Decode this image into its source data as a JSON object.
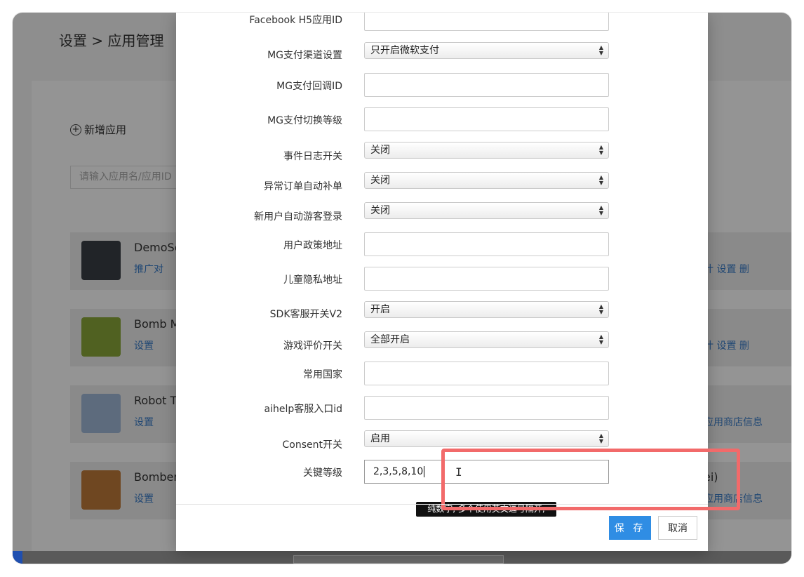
{
  "background": {
    "breadcrumb": "设置 > 应用管理",
    "add_app_label": "新增应用",
    "search_placeholder": "请输入应用名/应用ID",
    "apps": [
      {
        "name": "DemoSc",
        "sub": "推广对",
        "right": "计  设置  删",
        "icon_color": "#3a3f45"
      },
      {
        "name": "Bomb M",
        "sub": "设置",
        "right": "计  设置  删",
        "icon_color": "#8aa83a"
      },
      {
        "name": "Robot T",
        "sub": "设置",
        "right": "应用商店信息",
        "icon_color": "#a0b8d8"
      },
      {
        "name": "Bomber",
        "sub": "设置",
        "right": "应用商店信息",
        "right_top": "ei)",
        "icon_color": "#c07a3a"
      }
    ]
  },
  "modal": {
    "fields": [
      {
        "label": "Facebook H5应用ID",
        "type": "input",
        "value": ""
      },
      {
        "label": "MG支付渠道设置",
        "type": "select",
        "value": "只开启微软支付"
      },
      {
        "label": "MG支付回调ID",
        "type": "input",
        "value": ""
      },
      {
        "label": "MG支付切换等级",
        "type": "input",
        "value": ""
      },
      {
        "label": "事件日志开关",
        "type": "select",
        "value": "关闭"
      },
      {
        "label": "异常订单自动补单",
        "type": "select",
        "value": "关闭"
      },
      {
        "label": "新用户自动游客登录",
        "type": "select",
        "value": "关闭"
      },
      {
        "label": "用户政策地址",
        "type": "input",
        "value": ""
      },
      {
        "label": "儿童隐私地址",
        "type": "input",
        "value": ""
      },
      {
        "label": "SDK客服开关V2",
        "type": "select",
        "value": "开启"
      },
      {
        "label": "游戏评价开关",
        "type": "select",
        "value": "全部开启"
      },
      {
        "label": "常用国家",
        "type": "input",
        "value": ""
      },
      {
        "label": "aihelp客服入口id",
        "type": "input",
        "value": ""
      },
      {
        "label": "Consent开关",
        "type": "select",
        "value": "启用"
      }
    ],
    "key_levels": {
      "label": "关键等级",
      "value": "2,3,5,8,10"
    },
    "tooltip": "纯数字, 多个使用英文逗号隔开,",
    "save_label": "保 存",
    "cancel_label": "取消"
  },
  "colors": {
    "primary": "#2f8de4",
    "highlight": "#f26a6a"
  }
}
